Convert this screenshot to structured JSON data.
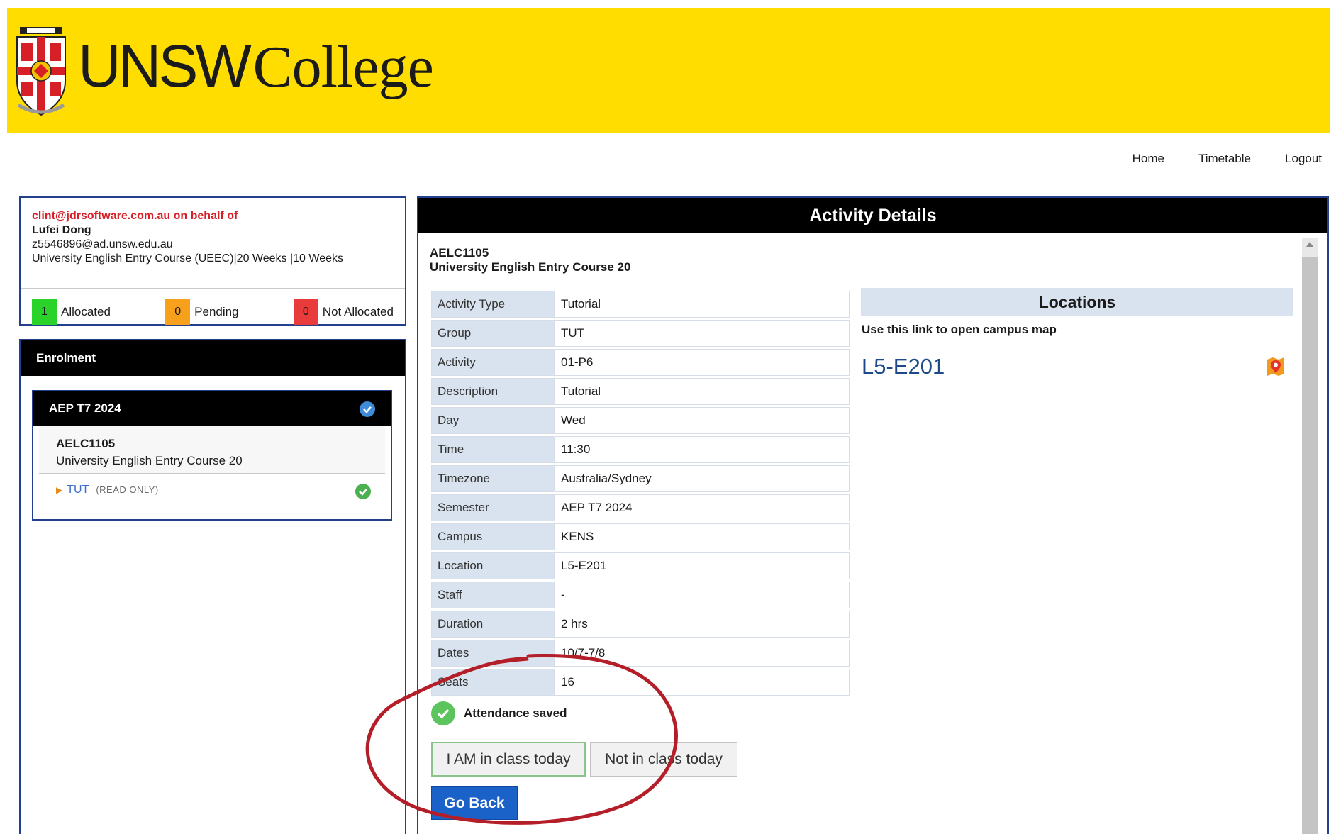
{
  "brand": {
    "name_part1": "UNSW",
    "name_part2": "College",
    "banner_color": "#ffdd00"
  },
  "topnav": {
    "items": [
      "Home",
      "Timetable",
      "Logout"
    ]
  },
  "user": {
    "behalf_text": "clint@jdrsoftware.com.au on behalf of",
    "name": "Lufei Dong",
    "email": "z5546896@ad.unsw.edu.au",
    "program": "University English Entry Course (UEEC)|20 Weeks |10 Weeks"
  },
  "allocation": {
    "allocated": {
      "count": "1",
      "label": "Allocated",
      "color": "#2ad32a"
    },
    "pending": {
      "count": "0",
      "label": "Pending",
      "color": "#f7a01c"
    },
    "not_allocated": {
      "count": "0",
      "label": "Not Allocated",
      "color": "#e93b3b"
    }
  },
  "enrolment": {
    "title": "Enrolment",
    "term": "AEP T7 2024",
    "course_code": "AELC1105",
    "course_name": "University English Entry Course 20",
    "activity": "TUT",
    "activity_flag": "(READ ONLY)"
  },
  "details": {
    "title": "Activity Details",
    "course_code": "AELC1105",
    "course_name": "University English Entry Course 20",
    "rows": [
      {
        "label": "Activity Type",
        "value": "Tutorial"
      },
      {
        "label": "Group",
        "value": "TUT"
      },
      {
        "label": "Activity",
        "value": "01-P6"
      },
      {
        "label": "Description",
        "value": "Tutorial"
      },
      {
        "label": "Day",
        "value": "Wed"
      },
      {
        "label": "Time",
        "value": "11:30"
      },
      {
        "label": "Timezone",
        "value": "Australia/Sydney"
      },
      {
        "label": "Semester",
        "value": "AEP T7 2024"
      },
      {
        "label": "Campus",
        "value": "KENS"
      },
      {
        "label": "Location",
        "value": "L5-E201"
      },
      {
        "label": "Staff",
        "value": "-"
      },
      {
        "label": "Duration",
        "value": "2 hrs"
      },
      {
        "label": "Dates",
        "value": "10/7-7/8"
      },
      {
        "label": "Seats",
        "value": "16"
      }
    ]
  },
  "locations": {
    "title": "Locations",
    "hint": "Use this link to open campus map",
    "room": "L5-E201",
    "icon": "map-marker-icon"
  },
  "attendance": {
    "status": "Attendance saved",
    "in_class_label": "I AM in class today",
    "not_in_class_label": "Not in class today",
    "back_label": "Go Back",
    "annotation_color": "#b41e28"
  }
}
